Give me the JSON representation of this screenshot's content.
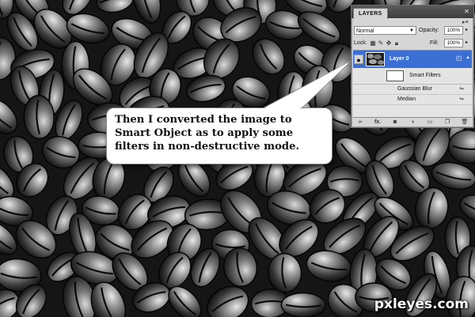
{
  "layers_panel": {
    "tab_title": "LAYERS",
    "blend_mode": "Normal",
    "opacity_label": "Opacity:",
    "opacity_value": "100%",
    "lock_label": "Lock:",
    "fill_label": "Fill:",
    "fill_value": "100%",
    "layer": {
      "name": "Layer 0"
    },
    "smart_filters_label": "Smart Filters",
    "filters": [
      {
        "name": "Gaussian Blur"
      },
      {
        "name": "Median"
      }
    ],
    "footer_icons": [
      "link-icon",
      "fx-icon",
      "mask-icon",
      "adjustment-icon",
      "group-icon",
      "new-layer-icon",
      "trash-icon"
    ]
  },
  "callout": {
    "text": "Then I converted the image to Smart Object as to apply some filters in non-destructive mode."
  },
  "watermark": "pxleyes.com",
  "colors": {
    "selected_layer": "#3b6fd3",
    "panel_bg": "#d6d6d6"
  }
}
